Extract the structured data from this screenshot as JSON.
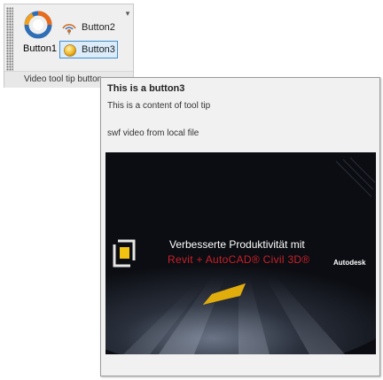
{
  "panel": {
    "title": "Video tool tip button",
    "buttons": [
      {
        "label": "Button1",
        "icon": "circular-logo-icon"
      },
      {
        "label": "Button2",
        "icon": "wifi-signal-icon"
      },
      {
        "label": "Button3",
        "icon": "yellow-orb-icon",
        "hovered": true
      }
    ]
  },
  "tooltip": {
    "title": "This is a button3",
    "content": "This is a content of tool tip",
    "expanded_content": "swf video from local file",
    "video": {
      "headline": "Verbesserte Produktivität mit",
      "product": "Revit + AutoCAD® Civil 3D®",
      "brand": "Autodesk"
    }
  },
  "colors": {
    "panel_bg": "#efefef",
    "hover_border": "#3f8fd0",
    "hover_fill": "#dcecfb",
    "tooltip_bg": "#f1f1f1",
    "video_bg": "#0b0d12",
    "product_red": "#c8202a",
    "accent_yellow": "#f3c314"
  }
}
